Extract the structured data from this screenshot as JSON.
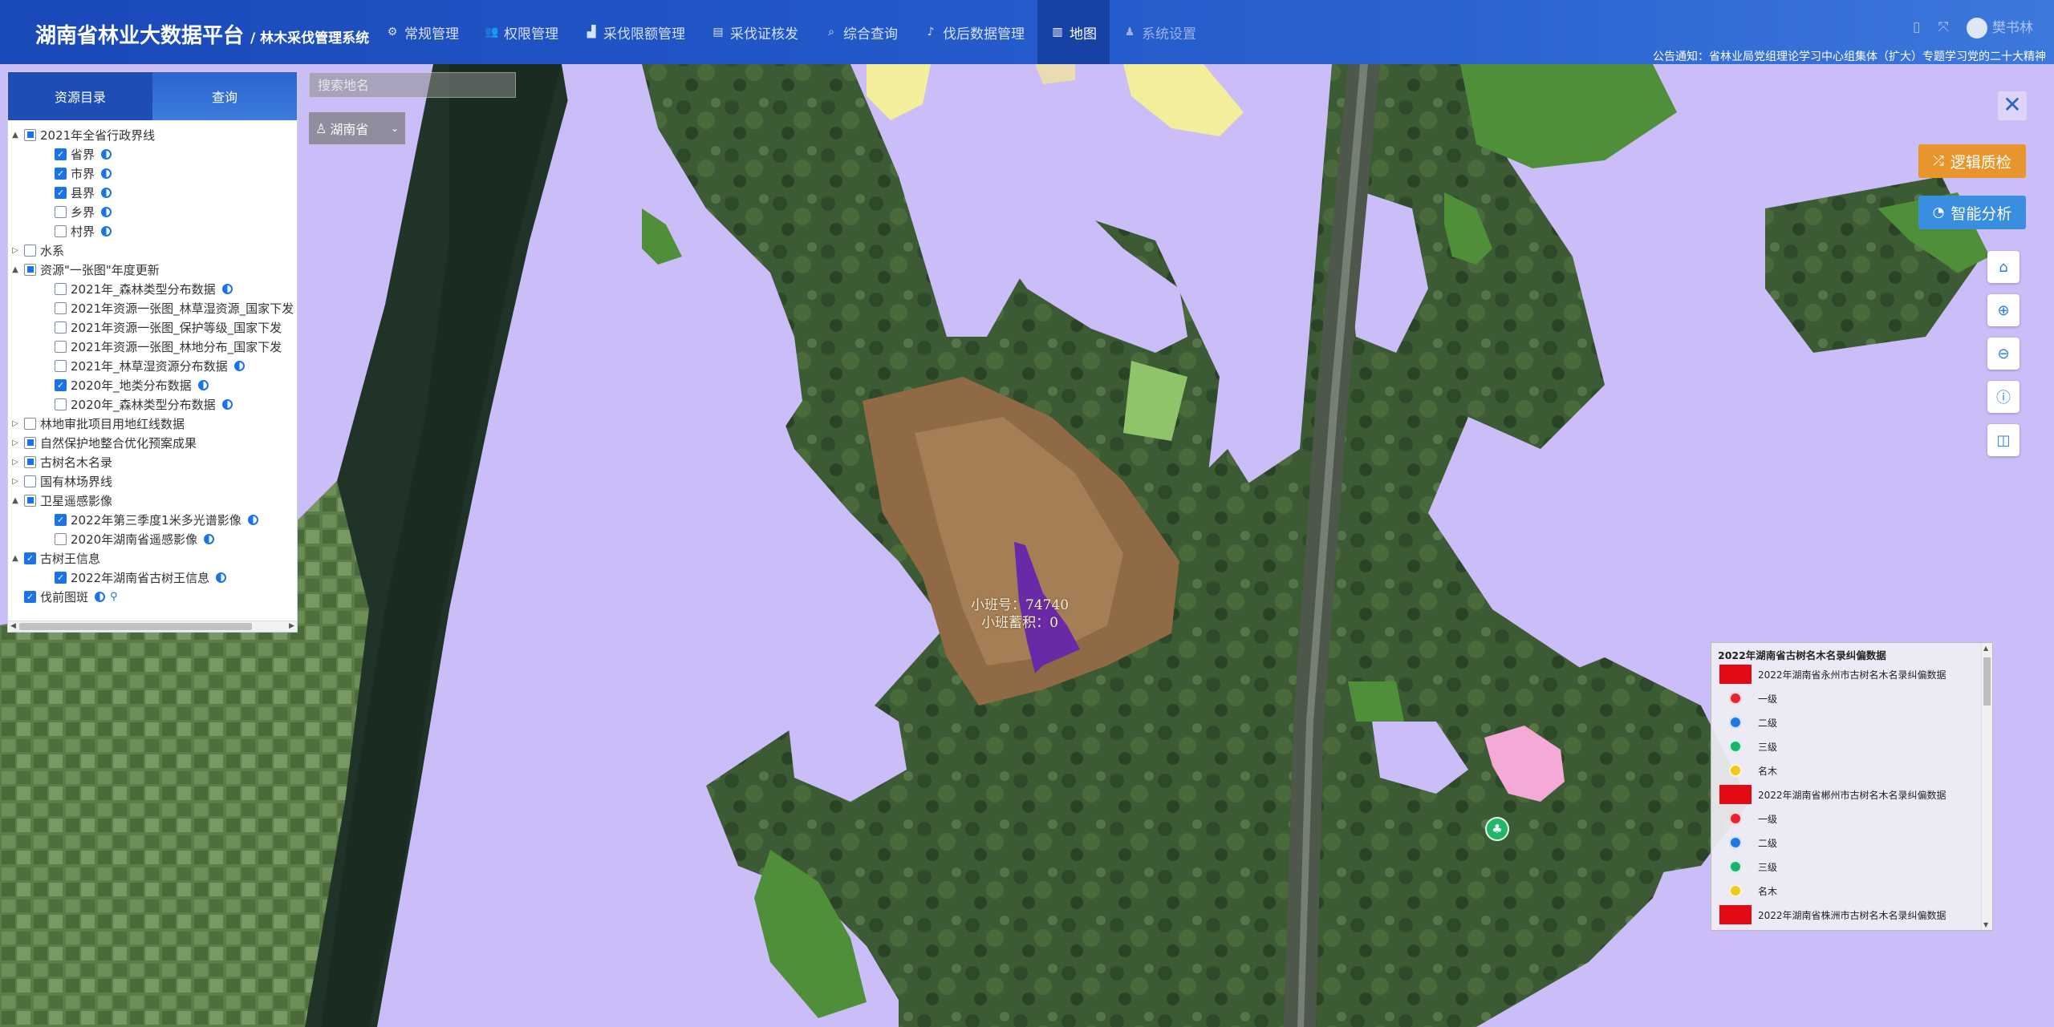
{
  "header": {
    "title": "湖南省林业大数据平台",
    "subtitle": "/ 林木采伐管理系统",
    "nav": [
      {
        "label": "常规管理",
        "icon": "gears-icon"
      },
      {
        "label": "权限管理",
        "icon": "users-icon"
      },
      {
        "label": "采伐限额管理",
        "icon": "bar-chart-icon"
      },
      {
        "label": "采伐证核发",
        "icon": "id-card-icon"
      },
      {
        "label": "综合查询",
        "icon": "search-icon"
      },
      {
        "label": "伐后数据管理",
        "icon": "bell-icon"
      },
      {
        "label": "地图",
        "icon": "map-icon"
      },
      {
        "label": "系统设置",
        "icon": "user-gear-icon"
      }
    ],
    "user_name": "樊书林",
    "notice": "公告通知：省林业局党组理论学习中心组集体（扩大）专题学习党的二十大精神"
  },
  "left_panel": {
    "tabs": [
      "资源目录",
      "查询"
    ],
    "tree": [
      {
        "label": "2021年全省行政界线",
        "level": 0,
        "arrow": "▲",
        "state": "partial",
        "info": false
      },
      {
        "label": "省界",
        "level": 1,
        "arrow": "",
        "state": "checked",
        "info": true
      },
      {
        "label": "市界",
        "level": 1,
        "arrow": "",
        "state": "checked",
        "info": true
      },
      {
        "label": "县界",
        "level": 1,
        "arrow": "",
        "state": "checked",
        "info": true
      },
      {
        "label": "乡界",
        "level": 1,
        "arrow": "",
        "state": "unchecked",
        "info": true
      },
      {
        "label": "村界",
        "level": 1,
        "arrow": "",
        "state": "unchecked",
        "info": true
      },
      {
        "label": "水系",
        "level": 0,
        "arrow": "▷",
        "state": "unchecked",
        "info": false
      },
      {
        "label": "资源\"一张图\"年度更新",
        "level": 0,
        "arrow": "▲",
        "state": "partial",
        "info": false
      },
      {
        "label": "2021年_森林类型分布数据",
        "level": 1,
        "arrow": "",
        "state": "unchecked",
        "info": true
      },
      {
        "label": "2021年资源一张图_林草湿资源_国家下发",
        "level": 1,
        "arrow": "",
        "state": "unchecked",
        "info": false
      },
      {
        "label": "2021年资源一张图_保护等级_国家下发",
        "level": 1,
        "arrow": "",
        "state": "unchecked",
        "info": false
      },
      {
        "label": "2021年资源一张图_林地分布_国家下发",
        "level": 1,
        "arrow": "",
        "state": "unchecked",
        "info": false
      },
      {
        "label": "2021年_林草湿资源分布数据",
        "level": 1,
        "arrow": "",
        "state": "unchecked",
        "info": true
      },
      {
        "label": "2020年_地类分布数据",
        "level": 1,
        "arrow": "",
        "state": "checked",
        "info": true
      },
      {
        "label": "2020年_森林类型分布数据",
        "level": 1,
        "arrow": "",
        "state": "unchecked",
        "info": true
      },
      {
        "label": "林地审批项目用地红线数据",
        "level": 0,
        "arrow": "▷",
        "state": "unchecked",
        "info": false
      },
      {
        "label": "自然保护地整合优化预案成果",
        "level": 0,
        "arrow": "▷",
        "state": "partial",
        "info": false
      },
      {
        "label": "古树名木名录",
        "level": 0,
        "arrow": "▷",
        "state": "partial",
        "info": false
      },
      {
        "label": "国有林场界线",
        "level": 0,
        "arrow": "▷",
        "state": "unchecked",
        "info": false
      },
      {
        "label": "卫星遥感影像",
        "level": 0,
        "arrow": "▲",
        "state": "partial",
        "info": false
      },
      {
        "label": "2022年第三季度1米多光谱影像",
        "level": 1,
        "arrow": "",
        "state": "checked",
        "info": true
      },
      {
        "label": "2020年湖南省遥感影像",
        "level": 1,
        "arrow": "",
        "state": "unchecked",
        "info": true
      },
      {
        "label": "古树王信息",
        "level": 0,
        "arrow": "▲",
        "state": "checked",
        "info": false
      },
      {
        "label": "2022年湖南省古树王信息",
        "level": 1,
        "arrow": "",
        "state": "checked",
        "info": true
      },
      {
        "label": "伐前图斑",
        "level": 0,
        "arrow": "",
        "state": "checked",
        "info": true,
        "pin": true
      }
    ]
  },
  "search": {
    "placeholder": "搜索地名"
  },
  "region": {
    "value": "湖南省"
  },
  "tools": {
    "logic_check": "逻辑质检",
    "smart_analysis": "智能分析"
  },
  "parcel": {
    "line1": "小班号：74740",
    "line2": "小班蓄积：0"
  },
  "legend": {
    "title": "2022年湖南省古树名木名录纠偏数据",
    "rows": [
      {
        "type": "rect",
        "label": "2022年湖南省永州市古树名木名录纠偏数据",
        "color": "#e30a14"
      },
      {
        "type": "pin",
        "label": "一级",
        "color": "#e8232a"
      },
      {
        "type": "pin",
        "label": "二级",
        "color": "#2178e0"
      },
      {
        "type": "pin",
        "label": "三级",
        "color": "#18b46c"
      },
      {
        "type": "pin",
        "label": "名木",
        "color": "#f2c81c"
      },
      {
        "type": "rect",
        "label": "2022年湖南省郴州市古树名木名录纠偏数据",
        "color": "#e30a14"
      },
      {
        "type": "pin",
        "label": "一级",
        "color": "#e8232a"
      },
      {
        "type": "pin",
        "label": "二级",
        "color": "#2178e0"
      },
      {
        "type": "pin",
        "label": "三级",
        "color": "#18b46c"
      },
      {
        "type": "pin",
        "label": "名木",
        "color": "#f2c81c"
      },
      {
        "type": "rect",
        "label": "2022年湖南省株洲市古树名木名录纠偏数据",
        "color": "#e30a14"
      }
    ]
  },
  "colors": {
    "accent": "#1e4db5",
    "map_lavender": "#cbbdf7",
    "parcel_purple": "#6a2aa8",
    "forest_green": "#4f8f3a",
    "logic_button": "#e8962b",
    "smart_button": "#3a8ee0"
  }
}
